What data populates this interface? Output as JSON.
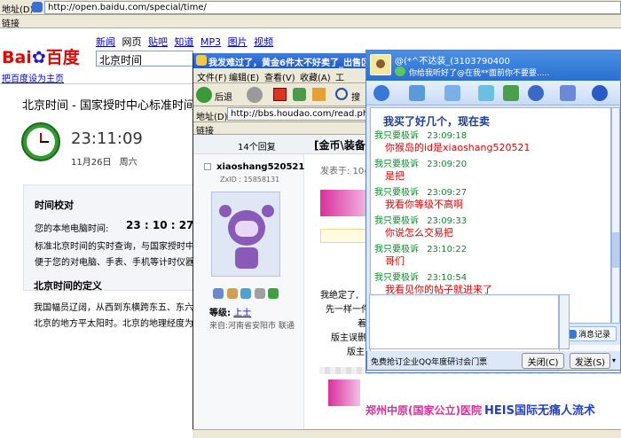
{
  "back_window": {
    "address_label": "地址(D)",
    "url": "http://open.baidu.com/special/time/",
    "links_label": "链接",
    "baidu_logo_text": "Bai百度",
    "nav": [
      "新闻",
      "网页",
      "贴吧",
      "知道",
      "MP3",
      "图片",
      "视频"
    ],
    "search_value": "北京时间",
    "set_home": "把百度设为主页",
    "page_heading": "北京时间 - 国家授时中心标准时间",
    "clock_time": "23:11:09",
    "clock_date": "11月26日",
    "clock_weekday": "周六",
    "calibrate_title": "时间校对",
    "local_time_label": "您的本地电脑时间:",
    "local_time_value": "23 : 10 : 27",
    "desc_line1": "标准北京时间的实时查询，与国家授时中",
    "desc_line2": "便于您的对电脑、手表、手机等计时仪器",
    "definition_title": "北京时间的定义",
    "def_line1": "我国幅员辽阔，从西到东横跨东五、东六",
    "def_line2": "北京的地方平太阳时。北京的地理经度为"
  },
  "forum_window": {
    "title": "我发难过了，黄金6件太不好卖了_出售区_第",
    "menu": [
      "文件(F)",
      "编辑(E)",
      "查看(V)",
      "收藏(A)",
      "工"
    ],
    "back_label": "后退",
    "search_label": "搜",
    "address_label": "地址(D)",
    "url": "http://bbs.houdao.com/read.php?",
    "links_label": "链接",
    "reply_count": "14个回复",
    "post_title_prefix": "[金币\\装备",
    "username": "xiaoshang520521",
    "user_id": "ZxID : 15858131",
    "post_time_label": "发表于: 10小",
    "level_label": "等级:",
    "level_value": "上士",
    "from_label": "来自:河南省安阳市 联通",
    "post_lines": [
      "我绝定了,",
      "先一样一件",
      "着",
      "版主误删",
      "版主"
    ],
    "banner_text1": "郑州中原(国家公立)医院",
    "banner_text2": "HEIS国际无痛人流术"
  },
  "qq_window": {
    "contact_name": "@(*^不达装_(3103790400",
    "signature": "你给我听好了@在我**面前你不要要.....",
    "messages": [
      {
        "sender": "",
        "time": "",
        "text": "我买了好几个，现在卖",
        "color": "#1a3d8f"
      },
      {
        "sender": "我只要极诉",
        "time": "23:09:18",
        "text": "你猴岛的id是xiaoshang520521",
        "color": "#e00000"
      },
      {
        "sender": "我只要极诉",
        "time": "23:09:20",
        "text": "是把",
        "color": "#e00000"
      },
      {
        "sender": "我只要极诉",
        "time": "23:09:27",
        "text": "我看你等级不高啊",
        "color": "#e00000"
      },
      {
        "sender": "我只要极诉",
        "time": "23:09:33",
        "text": "你说怎么交易把",
        "color": "#e00000"
      },
      {
        "sender": "我只要极诉",
        "time": "23:10:22",
        "text": "哥们",
        "color": "#e00000"
      },
      {
        "sender": "我只要极诉",
        "time": "23:10:54",
        "text": "我看见你的帖子就进来了",
        "color": "#e00000"
      }
    ],
    "history_btn": "消息记录",
    "ad_text": "免费抢订企业QQ年度研讨会门票",
    "close_btn": "关闭(C)",
    "send_btn": "发送(S)"
  }
}
